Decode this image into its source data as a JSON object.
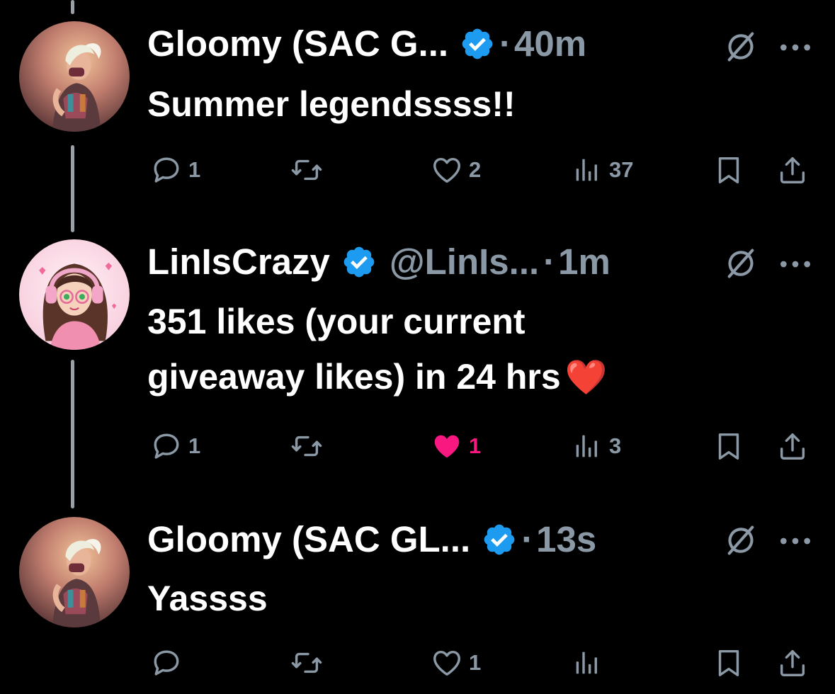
{
  "tweets": [
    {
      "name": "Gloomy (SAC G...",
      "handle": "",
      "time": "40m",
      "text": "Summer legendssss!!",
      "replies": "1",
      "reposts": "",
      "likes": "2",
      "liked": false,
      "views": "37",
      "avatar": "gloomy-avatar"
    },
    {
      "name": "LinIsCrazy",
      "handle": "@LinIs...",
      "time": "1m",
      "text_line1": "351 likes (your current",
      "text_line2": "giveaway likes) in 24 hrs",
      "emoji": "❤️",
      "replies": "1",
      "reposts": "",
      "likes": "1",
      "liked": true,
      "views": "3",
      "avatar": "liniscrazy-avatar"
    },
    {
      "name": "Gloomy (SAC GL...",
      "handle": "",
      "time": "13s",
      "text": "Yassss",
      "replies": "",
      "reposts": "",
      "likes": "1",
      "liked": false,
      "views": "",
      "avatar": "gloomy-avatar"
    }
  ],
  "separator": "·",
  "icons": {
    "reply": "reply-icon",
    "repost": "repost-icon",
    "like": "heart-icon",
    "views": "views-icon",
    "bookmark": "bookmark-icon",
    "share": "share-icon",
    "grok": "grok-icon",
    "more": "more-icon",
    "verified": "verified-badge-icon"
  },
  "colors": {
    "background": "#000000",
    "text": "#ffffff",
    "muted": "#8b98a5",
    "verified": "#1d9bf0",
    "liked": "#f91880",
    "thread_line": "#9aa0a6"
  }
}
